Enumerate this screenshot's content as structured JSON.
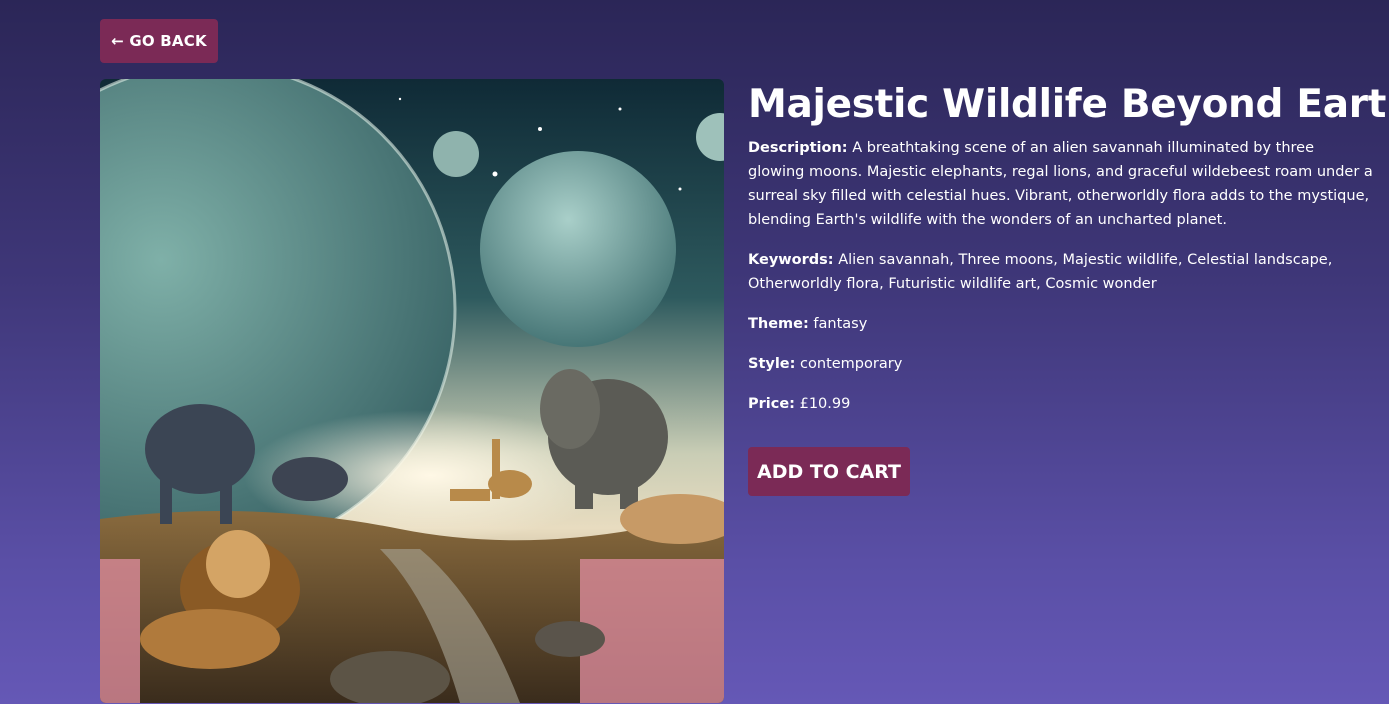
{
  "nav": {
    "back_label": "← GO BACK"
  },
  "product": {
    "title": "Majestic Wildlife Beyond Earth",
    "image_name": "alien-savannah-artwork",
    "description_label": "Description:",
    "description": "A breathtaking scene of an alien savannah illuminated by three glowing moons. Majestic elephants, regal lions, and graceful wildebeest roam under a surreal sky filled with celestial hues. Vibrant, otherworldly flora adds to the mystique, blending Earth's wildlife with the wonders of an uncharted planet.",
    "keywords_label": "Keywords:",
    "keywords": "Alien savannah, Three moons, Majestic wildlife, Celestial landscape, Otherworldly flora, Futuristic wildlife art, Cosmic wonder",
    "theme_label": "Theme:",
    "theme": "fantasy",
    "style_label": "Style:",
    "style": "contemporary",
    "price_label": "Price:",
    "price": "£10.99"
  },
  "actions": {
    "add_to_cart_label": "ADD TO CART"
  },
  "colors": {
    "background_top": "#2b2657",
    "background_bottom": "#6558b6",
    "button": "#7b2a56",
    "text": "#ffffff"
  }
}
